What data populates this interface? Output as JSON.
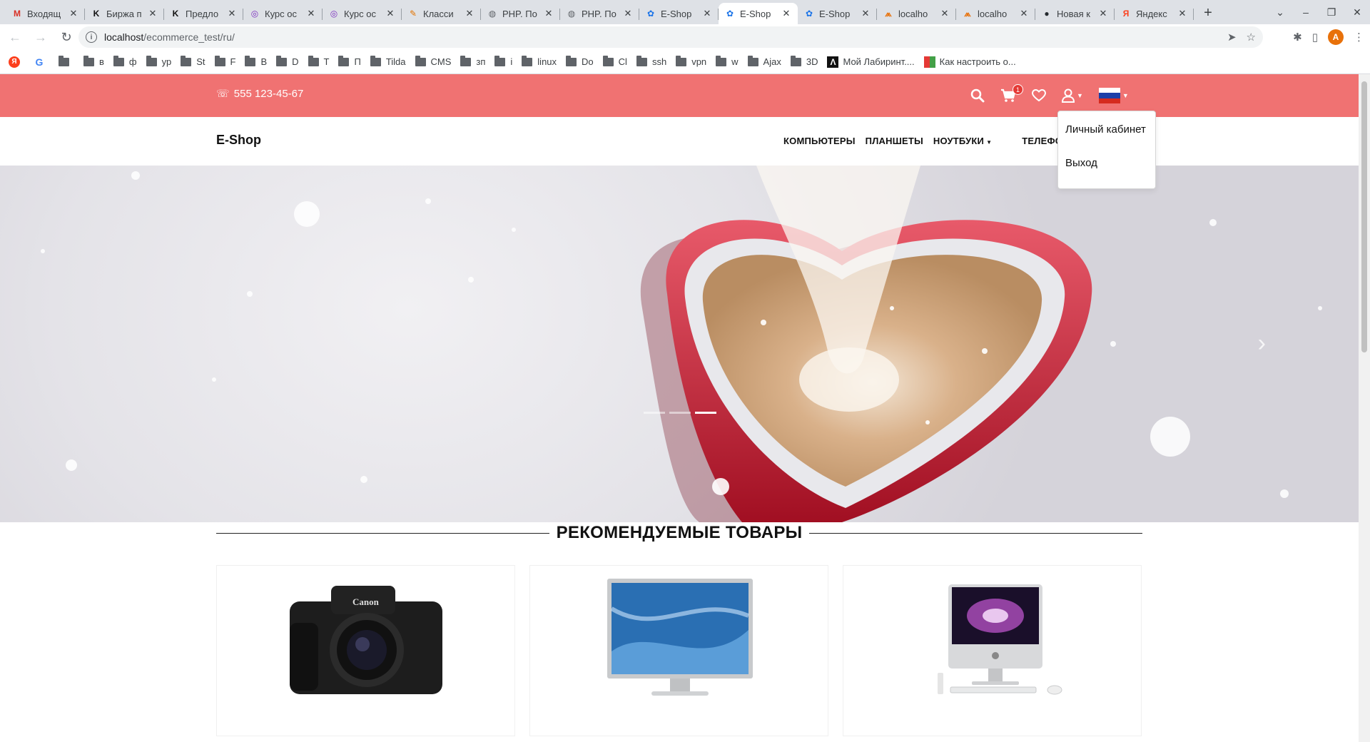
{
  "browser": {
    "tabs": [
      {
        "label": "Входящ",
        "favicon": "gmail-icon",
        "active": false
      },
      {
        "label": "Биржа п",
        "favicon": "k-icon",
        "active": false
      },
      {
        "label": "Предло",
        "favicon": "k-icon",
        "active": false
      },
      {
        "label": "Курс ос",
        "favicon": "course-icon",
        "active": false
      },
      {
        "label": "Курс ос",
        "favicon": "course-icon",
        "active": false
      },
      {
        "label": "Класси",
        "favicon": "note-icon",
        "active": false
      },
      {
        "label": "PHP. По",
        "favicon": "globe-icon",
        "active": false
      },
      {
        "label": "PHP. По",
        "favicon": "globe-icon",
        "active": false
      },
      {
        "label": "E-Shop",
        "favicon": "flower-icon",
        "active": false
      },
      {
        "label": "E-Shop",
        "favicon": "flower-icon",
        "active": true
      },
      {
        "label": "E-Shop",
        "favicon": "flower-icon",
        "active": false
      },
      {
        "label": "localho",
        "favicon": "pma-icon",
        "active": false
      },
      {
        "label": "localho",
        "favicon": "pma-icon",
        "active": false
      },
      {
        "label": "Новая к",
        "favicon": "github-icon",
        "active": false
      },
      {
        "label": "Яндекс",
        "favicon": "yandex-icon",
        "active": false
      }
    ],
    "url_host": "localhost",
    "url_path": "/ecommerce_test/ru/",
    "profile_initial": "A",
    "bookmarks": [
      {
        "label": "",
        "icon": "yandex-icon"
      },
      {
        "label": "",
        "icon": "google-icon"
      },
      {
        "label": "",
        "icon": "folder-icon"
      },
      {
        "label": "в",
        "icon": "folder-icon"
      },
      {
        "label": "ф",
        "icon": "folder-icon"
      },
      {
        "label": "ур",
        "icon": "folder-icon"
      },
      {
        "label": "St",
        "icon": "folder-icon"
      },
      {
        "label": "F",
        "icon": "folder-icon"
      },
      {
        "label": "В",
        "icon": "folder-icon"
      },
      {
        "label": "D",
        "icon": "folder-icon"
      },
      {
        "label": "Т",
        "icon": "folder-icon"
      },
      {
        "label": "П",
        "icon": "folder-icon"
      },
      {
        "label": "Tilda",
        "icon": "folder-icon"
      },
      {
        "label": "CMS",
        "icon": "folder-icon"
      },
      {
        "label": "зп",
        "icon": "folder-icon"
      },
      {
        "label": "i",
        "icon": "folder-icon"
      },
      {
        "label": "linux",
        "icon": "folder-icon"
      },
      {
        "label": "Do",
        "icon": "folder-icon"
      },
      {
        "label": "Cl",
        "icon": "folder-icon"
      },
      {
        "label": "ssh",
        "icon": "folder-icon"
      },
      {
        "label": "vpn",
        "icon": "folder-icon"
      },
      {
        "label": "w",
        "icon": "folder-icon"
      },
      {
        "label": "Ajax",
        "icon": "folder-icon"
      },
      {
        "label": "3D",
        "icon": "folder-icon"
      },
      {
        "label": "Мой Лабиринт....",
        "icon": "labirint-icon"
      },
      {
        "label": "Как настроить о...",
        "icon": "colorful-icon"
      }
    ]
  },
  "site": {
    "phone": "555 123-45-67",
    "cart_count": "1",
    "brand": "E-Shop",
    "menu": [
      "КОМПЬЮТЕРЫ",
      "ПЛАНШЕТЫ",
      "НОУТБУКИ",
      "ТЕЛЕФОНЫ"
    ],
    "account_menu": [
      "Личный кабинет",
      "Выход"
    ],
    "language_flag": "ru-flag-icon",
    "slider_count": 3,
    "slider_active": 3,
    "section_title": "РЕКОМЕНДУЕМЫЕ ТОВАРЫ",
    "products": [
      {
        "image": "camera-image"
      },
      {
        "image": "monitor-image"
      },
      {
        "image": "imac-image"
      }
    ]
  },
  "colors": {
    "topbar": "#f07272",
    "chrome_tabbar": "#dee1e6",
    "badge": "#e53935"
  }
}
